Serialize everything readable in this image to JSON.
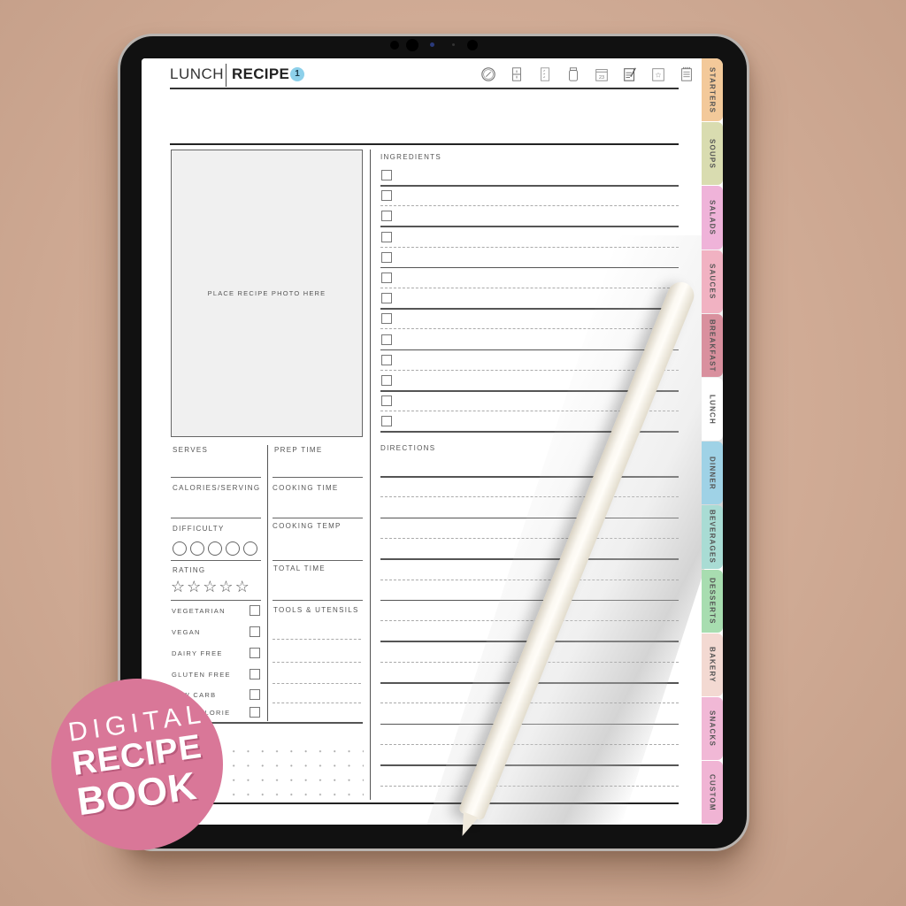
{
  "header": {
    "section": "LUNCH",
    "title": "RECIPE",
    "page_number": "1",
    "nav_icons": [
      {
        "name": "compass-icon"
      },
      {
        "name": "fridge-icon"
      },
      {
        "name": "checklist-icon"
      },
      {
        "name": "jar-icon"
      },
      {
        "name": "calendar-icon",
        "text": "23"
      },
      {
        "name": "notepad-icon"
      },
      {
        "name": "favorite-star-icon"
      },
      {
        "name": "notes-icon"
      }
    ]
  },
  "photo": {
    "placeholder": "PLACE RECIPE PHOTO HERE"
  },
  "ingredients": {
    "label": "INGREDIENTS",
    "row_count": 13
  },
  "directions": {
    "label": "DIRECTIONS",
    "line_count": 16
  },
  "stats_left": {
    "serves": "SERVES",
    "calories": "CALORIES/SERVING",
    "difficulty": "DIFFICULTY",
    "difficulty_value": 0,
    "difficulty_max": 5,
    "rating": "RATING",
    "rating_value": 0,
    "rating_max": 5,
    "star_glyph": "☆"
  },
  "stats_right": {
    "prep_time": "PREP TIME",
    "cooking_time": "COOKING TIME",
    "cooking_temp": "COOKING TEMP",
    "total_time": "TOTAL TIME",
    "tools": "TOOLS & UTENSILS"
  },
  "diet": [
    {
      "label": "VEGETARIAN",
      "checked": false
    },
    {
      "label": "VEGAN",
      "checked": false
    },
    {
      "label": "DAIRY FREE",
      "checked": false
    },
    {
      "label": "GLUTEN FREE",
      "checked": false
    },
    {
      "label": "LOW CARB",
      "checked": false
    },
    {
      "label": "LOW CALORIE",
      "checked": false
    }
  ],
  "tabs": [
    {
      "label": "STARTERS",
      "color": "#f3c99a"
    },
    {
      "label": "SOUPS",
      "color": "#d9dcb0"
    },
    {
      "label": "SALADS",
      "color": "#efb3d9"
    },
    {
      "label": "SAUCES",
      "color": "#f1b2c2"
    },
    {
      "label": "BREAKFAST",
      "color": "#d9909e"
    },
    {
      "label": "LUNCH",
      "color": "#ffffff"
    },
    {
      "label": "DINNER",
      "color": "#9fd2e6"
    },
    {
      "label": "BEVERAGES",
      "color": "#a9dcd4"
    },
    {
      "label": "DESSERTS",
      "color": "#a8ddb0"
    },
    {
      "label": "BAKERY",
      "color": "#f3d9d2"
    },
    {
      "label": "SNACKS",
      "color": "#f1b8d6"
    },
    {
      "label": "CUSTOM",
      "color": "#f0b4d4"
    }
  ],
  "promo_badge": {
    "line1": "DIGITAL",
    "line2": "RECIPE",
    "line3": "BOOK",
    "color": "#d97798"
  }
}
